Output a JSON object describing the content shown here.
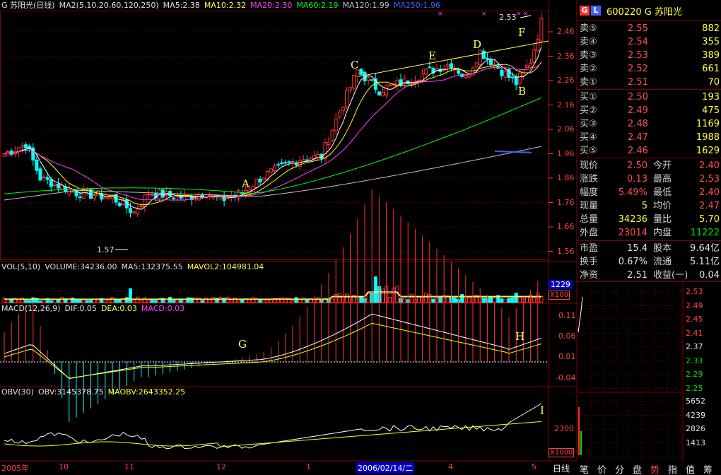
{
  "kline_header": {
    "name": "G 苏阳光(日线)",
    "ma_spec": "MA2(5,10,20,60,120,250)",
    "ma5": "MA5:2.38",
    "ma10": "MA10:2.32",
    "ma20": "MA20:2.30",
    "ma60": "MA60:2.19",
    "ma120": "MA120:1.99",
    "ma250": "MA250:1.96"
  },
  "vol_header": {
    "name": "VOL(5,10)",
    "volume": "VOLUME:34236.00",
    "ma5": "MA5:132375.55",
    "mavol2": "MAVOL2:104981.04"
  },
  "macd_header": {
    "name": "MACD(12,26,9)",
    "dif": "DIF:0.05",
    "dea": "DEA:0.03",
    "macd": "MACD:0.03"
  },
  "obv_header": {
    "name": "OBV(30)",
    "obv": "OBV:3145378.75",
    "maobv": "MAOBV:2643352.25"
  },
  "price_ticks": [
    "2.46",
    "2.36",
    "2.26",
    "2.16",
    "2.06",
    "1.96",
    "1.86",
    "1.76",
    "1.66",
    "1.56"
  ],
  "vol_ticks": [
    "1229",
    "X100"
  ],
  "macd_ticks": [
    "0.11",
    "0.06",
    "0.01",
    "-0.04"
  ],
  "obv_ticks": [
    "2300",
    "X1000"
  ],
  "mini_price_ticks": [
    "2.53",
    "2.49",
    "2.45",
    "2.41",
    "2.37",
    "2.33",
    "2.29",
    "2.25"
  ],
  "mini_vol_ticks": [
    "5652",
    "4239",
    "2826",
    "1413"
  ],
  "x_axis": {
    "labels": [
      "2005年",
      "10",
      "11",
      "12",
      "1",
      "2",
      "3",
      "4",
      "5"
    ],
    "cursor_date": "2006/02/14/二",
    "period": "日线"
  },
  "annotations": {
    "low": "1.57",
    "high": "2.53",
    "letters": [
      "A",
      "B",
      "C",
      "D",
      "E",
      "F",
      "G",
      "H",
      "I"
    ]
  },
  "quote": {
    "badge_g": "G",
    "badge_l": "L",
    "code_name": "600220 G 苏阳光",
    "asks": [
      {
        "label": "卖⑤",
        "price": "2.55",
        "vol": "882"
      },
      {
        "label": "卖④",
        "price": "2.54",
        "vol": "355"
      },
      {
        "label": "卖③",
        "price": "2.53",
        "vol": "389"
      },
      {
        "label": "卖②",
        "price": "2.52",
        "vol": "661"
      },
      {
        "label": "卖①",
        "price": "2.51",
        "vol": "70"
      }
    ],
    "bids": [
      {
        "label": "买①",
        "price": "2.50",
        "vol": "193"
      },
      {
        "label": "买②",
        "price": "2.49",
        "vol": "475"
      },
      {
        "label": "买③",
        "price": "2.48",
        "vol": "1169"
      },
      {
        "label": "买④",
        "price": "2.47",
        "vol": "1988"
      },
      {
        "label": "买⑤",
        "price": "2.46",
        "vol": "1629"
      }
    ],
    "stats": [
      {
        "l1": "现价",
        "v1": "2.50",
        "l2": "今开",
        "v2": "2.40"
      },
      {
        "l1": "涨跌",
        "v1": "0.13",
        "l2": "最高",
        "v2": "2.53"
      },
      {
        "l1": "幅度",
        "v1": "5.49%",
        "l2": "最低",
        "v2": "2.40"
      },
      {
        "l1": "现量",
        "v1": "5",
        "l2": "均价",
        "v2": "2.47"
      },
      {
        "l1": "总量",
        "v1": "34236",
        "l2": "量比",
        "v2": "5.70"
      },
      {
        "l1": "外盘",
        "v1": "23014",
        "l2": "内盘",
        "v2": "11222"
      }
    ],
    "fund": [
      {
        "l1": "市盈",
        "v1": "15.4",
        "l2": "股本",
        "v2": "9.64亿"
      },
      {
        "l1": "换手",
        "v1": "0.67%",
        "l2": "流通",
        "v2": "5.11亿"
      },
      {
        "l1": "净资",
        "v1": "2.51",
        "l2": "收益(一)",
        "v2": "0.04"
      }
    ]
  },
  "tabs": [
    "笔",
    "价",
    "分",
    "盘",
    "势",
    "指",
    "值",
    "筹"
  ],
  "colors": {
    "up": "#ff3030",
    "down": "#00ffff",
    "ma5": "#ffffff",
    "ma10": "#ffff00",
    "ma20": "#ff40ff",
    "ma60": "#00ff00",
    "ma120": "#c0c0c0",
    "ma250": "#4060ff",
    "grid": "#800000"
  }
}
